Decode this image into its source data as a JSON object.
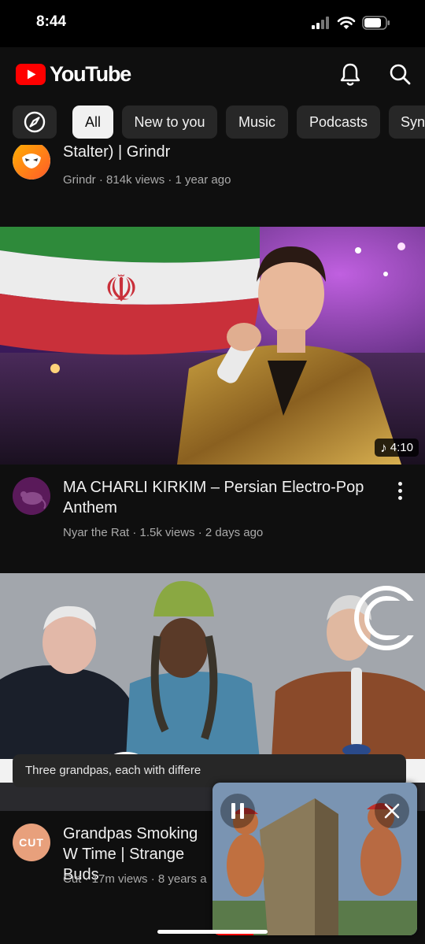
{
  "status": {
    "time": "8:44"
  },
  "header": {
    "brand": "YouTube"
  },
  "chips": {
    "items": [
      "All",
      "New to you",
      "Music",
      "Podcasts",
      "Synt"
    ],
    "selected": "All"
  },
  "videos": [
    {
      "title_partial": "Stalter) | Grindr",
      "channel": "Grindr",
      "meta": "Grindr · 814k views · 1 year ago"
    },
    {
      "title": "MA CHARLI KIRKIM – Persian Electro-Pop Anthem",
      "meta": "Nyar the Rat · 1.5k views · 2 days ago",
      "duration": "4:10",
      "duration_icon": "music-note-icon"
    },
    {
      "title": "Grandpas Smoking W Time | Strange Buds",
      "meta": "Cut · 17m views · 8 years a",
      "channel_avatar_text": "CUT"
    }
  ],
  "description_preview": "Three grandpas, each with differe",
  "miniplayer": {
    "progress": 0.2
  },
  "colors": {
    "brand_red": "#ff0000",
    "background": "#0f0f0f",
    "chip_bg": "#272727",
    "chip_active": "#f1f1f1",
    "cut_avatar": "#e8a07c"
  }
}
